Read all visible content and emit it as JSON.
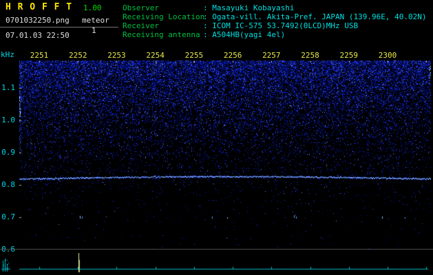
{
  "header": {
    "app_title": "H R O F F T",
    "version": "1.00",
    "filename": "0701032250.png",
    "mode_label": "meteor",
    "mode_count": "1",
    "timestamp": "07.01.03 22:50",
    "info_rows": [
      {
        "label": "Observer",
        "value": ": Masayuki Kobayashi"
      },
      {
        "label": "Receiving Location",
        "value": ": Ogata-vill. Akita-Pref. JAPAN (139.96E, 40.02N)"
      },
      {
        "label": "Receiver",
        "value": ": ICOM IC-575 53.7492(0LCD)MHz USB"
      },
      {
        "label": "Receiving antenna",
        "value": ": A504HB(yagi 4el)"
      }
    ]
  },
  "spectrogram": {
    "unit_label": "kHz",
    "time_labels": [
      "2251",
      "2252",
      "2253",
      "2254",
      "2255",
      "2256",
      "2257",
      "2258",
      "2259",
      "2300"
    ],
    "freq_labels": [
      "1.1",
      "1.0",
      "0.9",
      "0.8",
      "0.7",
      "0.6"
    ],
    "carrier_line_khz": 0.82,
    "echo_spike_time": "2252"
  },
  "colors": {
    "title_yellow": "#ffe600",
    "version_green": "#00dd00",
    "text_white": "#e0e0e0",
    "label_green": "#00c040",
    "value_cyan": "#00e0e0",
    "time_label_yellow": "#e8e84a",
    "freq_label_cyan": "#00d8e8",
    "noise_blue": "#1428dd",
    "carrier_blue": "#7fb2ff",
    "strip_cyan": "#00b8c8",
    "spike_yellow": "#e4f0a0"
  }
}
